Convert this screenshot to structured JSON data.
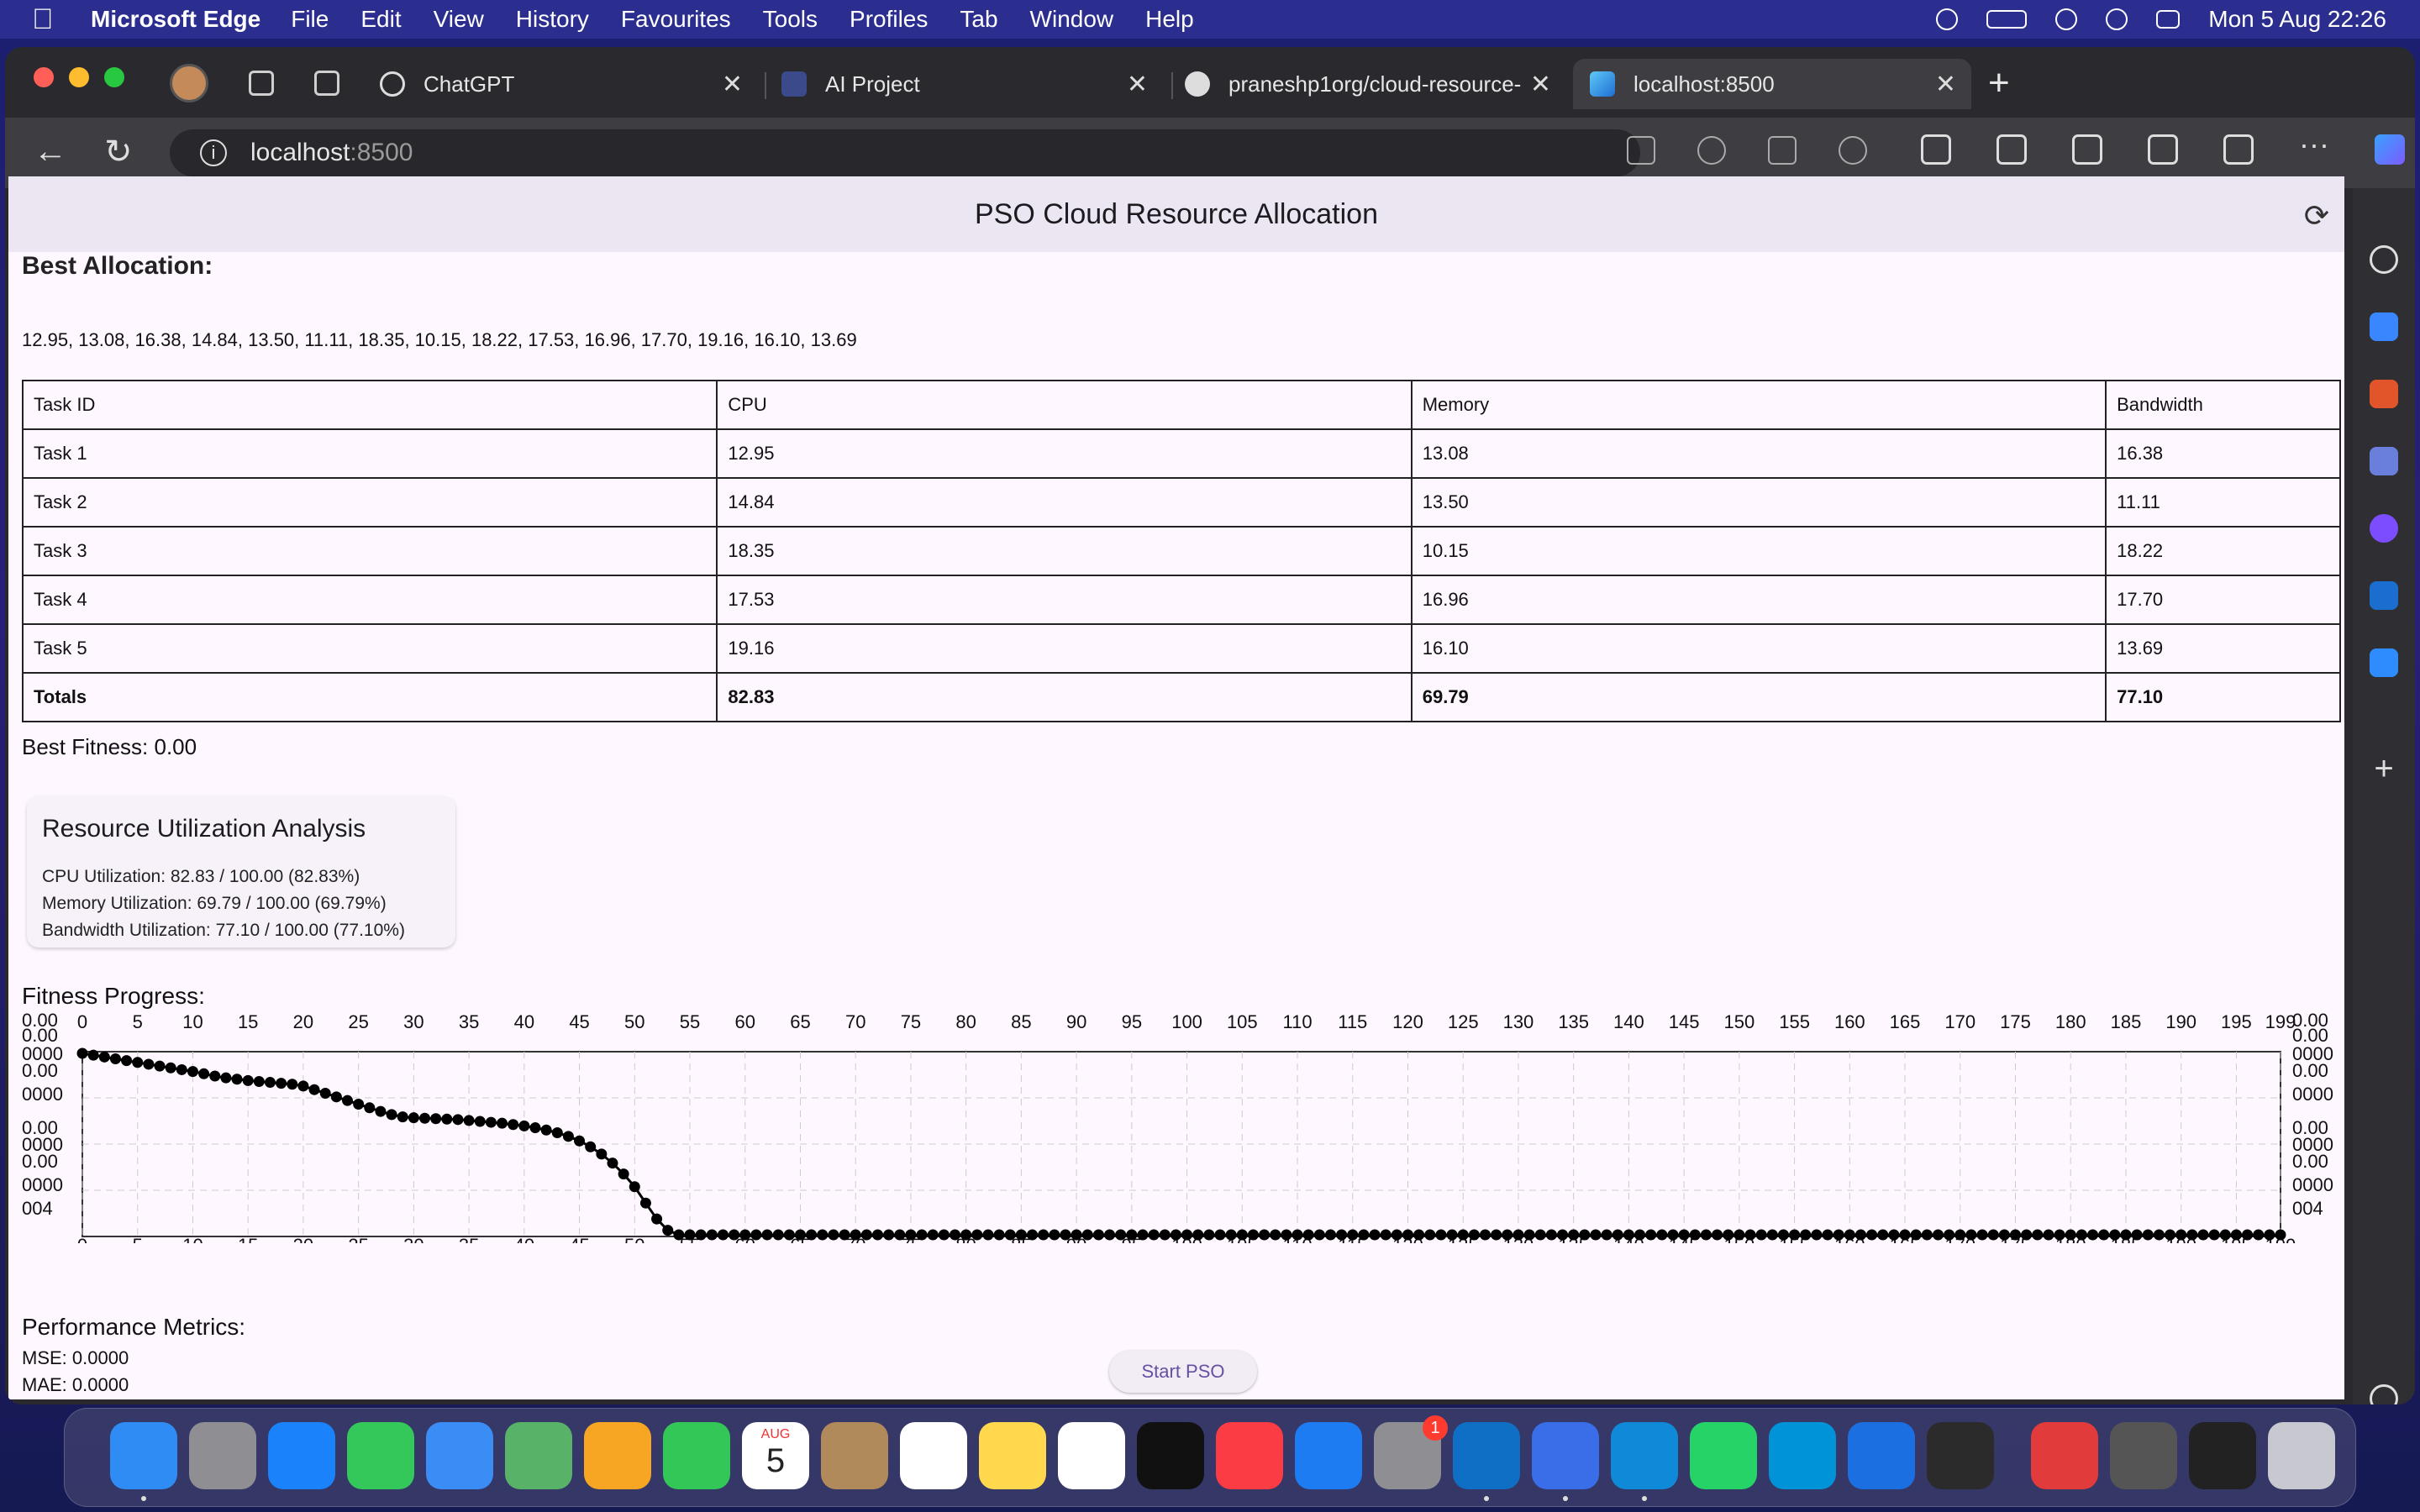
{
  "menubar": {
    "app_name": "Microsoft Edge",
    "items": [
      "File",
      "Edit",
      "View",
      "History",
      "Favourites",
      "Tools",
      "Profiles",
      "Tab",
      "Window",
      "Help"
    ],
    "clock": "Mon 5 Aug  22:26"
  },
  "tabs": [
    {
      "label": "ChatGPT",
      "icon": "chatgpt-icon"
    },
    {
      "label": "AI Project",
      "icon": "document-icon"
    },
    {
      "label": "praneshp1org/cloud-resource-",
      "icon": "github-icon"
    },
    {
      "label": "localhost:8500",
      "icon": "flutter-icon"
    }
  ],
  "address": {
    "host": "localhost",
    "port": ":8500"
  },
  "page": {
    "app_title": "PSO Cloud Resource Allocation",
    "best_allocation_title": "Best Allocation:",
    "best_allocation_values": "12.95, 13.08, 16.38, 14.84, 13.50, 11.11, 18.35, 10.15, 18.22, 17.53, 16.96, 17.70, 19.16, 16.10, 13.69",
    "table": {
      "headers": [
        "Task ID",
        "CPU",
        "Memory",
        "Bandwidth"
      ],
      "rows": [
        [
          "Task 1",
          "12.95",
          "13.08",
          "16.38"
        ],
        [
          "Task 2",
          "14.84",
          "13.50",
          "11.11"
        ],
        [
          "Task 3",
          "18.35",
          "10.15",
          "18.22"
        ],
        [
          "Task 4",
          "17.53",
          "16.96",
          "17.70"
        ],
        [
          "Task 5",
          "19.16",
          "16.10",
          "13.69"
        ]
      ],
      "totals": [
        "Totals",
        "82.83",
        "69.79",
        "77.10"
      ]
    },
    "best_fitness": "Best Fitness: 0.00",
    "utilization": {
      "title": "Resource Utilization Analysis",
      "cpu": "CPU Utilization: 82.83 / 100.00 (82.83%)",
      "memory": "Memory Utilization: 69.79 / 100.00 (69.79%)",
      "bandwidth": "Bandwidth Utilization: 77.10 / 100.00 (77.10%)"
    },
    "fitness_title": "Fitness Progress:",
    "metrics_title": "Performance Metrics:",
    "mse": "MSE: 0.0000",
    "mae": "MAE: 0.0000",
    "start_button": "Start PSO"
  },
  "chart_data": {
    "type": "line",
    "title": "",
    "xlabel": "",
    "ylabel": "",
    "x_ticks": [
      0,
      5,
      10,
      15,
      20,
      25,
      30,
      35,
      40,
      45,
      50,
      55,
      60,
      65,
      70,
      75,
      80,
      85,
      90,
      95,
      100,
      105,
      110,
      115,
      120,
      125,
      130,
      135,
      140,
      145,
      150,
      155,
      160,
      165,
      170,
      175,
      180,
      185,
      190,
      195,
      199
    ],
    "y_tick_labels": [
      "0.00",
      "0.00",
      "0000",
      "0.00",
      "0000",
      "0.00",
      "0000",
      "0.00",
      "0000",
      "004"
    ],
    "xlim": [
      0,
      199
    ],
    "ylim": [
      0.0,
      0.004
    ],
    "grid": true,
    "series": [
      {
        "points": [
          [
            0,
            0.004
          ],
          [
            1,
            0.00396
          ],
          [
            2,
            0.00392
          ],
          [
            3,
            0.00388
          ],
          [
            4,
            0.00384
          ],
          [
            5,
            0.0038
          ],
          [
            6,
            0.00376
          ],
          [
            7,
            0.00372
          ],
          [
            8,
            0.00368
          ],
          [
            9,
            0.00364
          ],
          [
            10,
            0.0036
          ],
          [
            11,
            0.00355
          ],
          [
            12,
            0.0035
          ],
          [
            13,
            0.00346
          ],
          [
            14,
            0.00343
          ],
          [
            15,
            0.0034
          ],
          [
            16,
            0.00338
          ],
          [
            17,
            0.00336
          ],
          [
            18,
            0.00334
          ],
          [
            19,
            0.00332
          ],
          [
            20,
            0.00328
          ],
          [
            21,
            0.0032
          ],
          [
            22,
            0.00312
          ],
          [
            23,
            0.00304
          ],
          [
            24,
            0.00296
          ],
          [
            25,
            0.00288
          ],
          [
            26,
            0.0028
          ],
          [
            27,
            0.00272
          ],
          [
            28,
            0.00265
          ],
          [
            29,
            0.0026
          ],
          [
            30,
            0.00258
          ],
          [
            31,
            0.00257
          ],
          [
            32,
            0.00256
          ],
          [
            33,
            0.00255
          ],
          [
            34,
            0.00254
          ],
          [
            35,
            0.00252
          ],
          [
            36,
            0.0025
          ],
          [
            37,
            0.00248
          ],
          [
            38,
            0.00246
          ],
          [
            39,
            0.00243
          ],
          [
            40,
            0.0024
          ],
          [
            41,
            0.00236
          ],
          [
            42,
            0.00231
          ],
          [
            43,
            0.00225
          ],
          [
            44,
            0.00217
          ],
          [
            45,
            0.00207
          ],
          [
            46,
            0.00194
          ],
          [
            47,
            0.00178
          ],
          [
            48,
            0.00158
          ],
          [
            49,
            0.00134
          ],
          [
            50,
            0.00106
          ],
          [
            51,
            0.0007
          ],
          [
            52,
            0.00035
          ],
          [
            53,
            0.0001
          ],
          [
            54,
            0.0
          ],
          [
            55,
            0.0
          ],
          [
            60,
            0.0
          ],
          [
            65,
            0.0
          ],
          [
            70,
            0.0
          ],
          [
            75,
            0.0
          ],
          [
            80,
            0.0
          ],
          [
            85,
            0.0
          ],
          [
            90,
            0.0
          ],
          [
            95,
            0.0
          ],
          [
            100,
            0.0
          ],
          [
            105,
            0.0
          ],
          [
            110,
            0.0
          ],
          [
            115,
            0.0
          ],
          [
            120,
            0.0
          ],
          [
            125,
            0.0
          ],
          [
            130,
            0.0
          ],
          [
            135,
            0.0
          ],
          [
            140,
            0.0
          ],
          [
            145,
            0.0
          ],
          [
            150,
            0.0
          ],
          [
            155,
            0.0
          ],
          [
            160,
            0.0
          ],
          [
            165,
            0.0
          ],
          [
            170,
            0.0
          ],
          [
            175,
            0.0
          ],
          [
            180,
            0.0
          ],
          [
            185,
            0.0
          ],
          [
            190,
            0.0
          ],
          [
            195,
            0.0
          ],
          [
            199,
            0.0
          ]
        ]
      }
    ]
  },
  "dock": [
    "finder-icon",
    "launchpad-icon",
    "safari-icon",
    "messages-icon",
    "mail-icon",
    "maps-icon",
    "photos-icon",
    "facetime-icon",
    "calendar-icon",
    "contacts-icon",
    "reminders-icon",
    "notes-icon",
    "freeform-icon",
    "tv-icon",
    "music-icon",
    "appstore-icon",
    "settings-icon",
    "vscode-icon",
    "xcode-icon",
    "edge-icon",
    "whatsapp-icon",
    "skype-icon",
    "instruments-icon",
    "terminal-exec-icon",
    "news-icon",
    "calculator-icon",
    "terminal-icon",
    "trash-icon"
  ],
  "dock_calendar": {
    "month": "AUG",
    "day": "5"
  },
  "dock_settings_badge": "1",
  "colors": {
    "accent": "#6750a4",
    "appbar": "#ece6f3",
    "page_bg": "#fef7ff"
  }
}
